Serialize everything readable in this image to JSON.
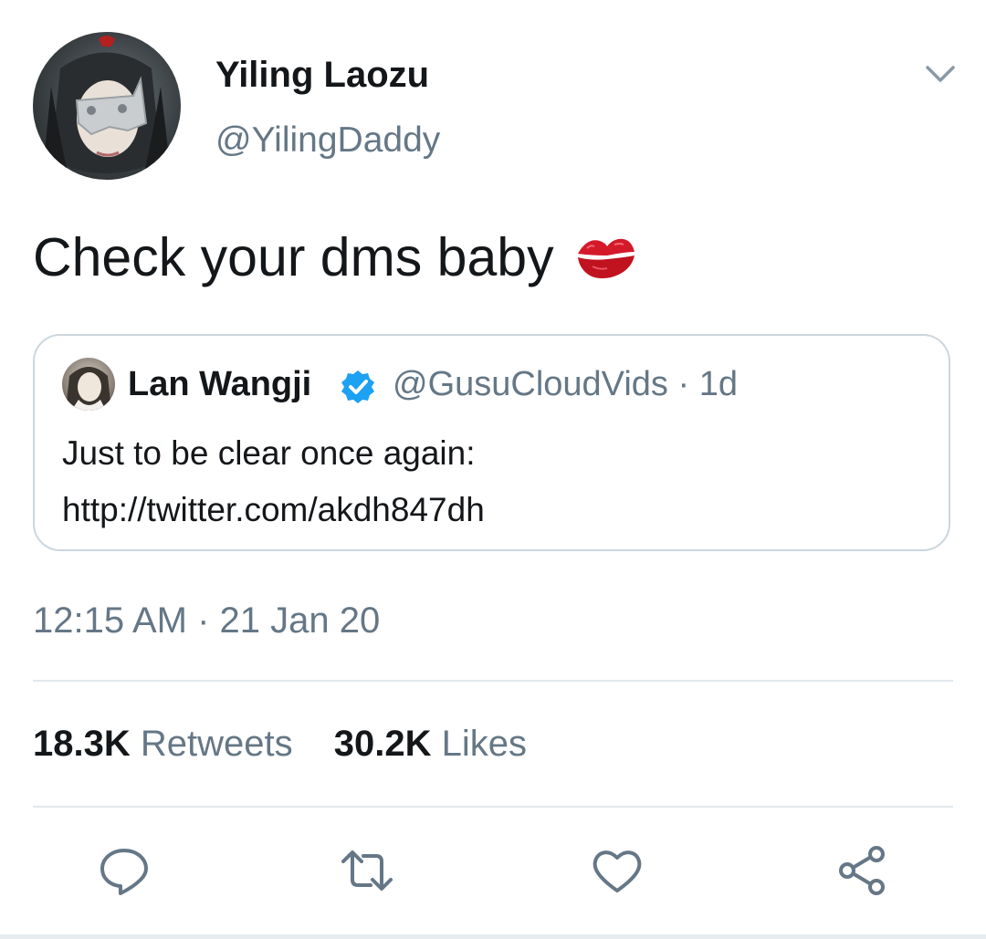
{
  "author": {
    "display_name": "Yiling Laozu",
    "handle": "@YilingDaddy"
  },
  "tweet_text": "Check your dms baby",
  "tweet_emoji": "kiss-mark-icon",
  "quoted_tweet": {
    "display_name": "Lan Wangji",
    "verified_icon": "verified-badge-icon",
    "handle_and_time": "@GusuCloudVids · 1d",
    "text_line1": "Just to be clear once again:",
    "text_line2": "http://twitter.com/akdh847dh"
  },
  "timestamp": "12:15 AM · 21 Jan 20",
  "stats": {
    "retweets_count": "18.3K",
    "retweets_label": "Retweets",
    "likes_count": "30.2K",
    "likes_label": "Likes"
  },
  "actions": [
    "reply-icon",
    "retweet-icon",
    "like-icon",
    "share-icon"
  ],
  "colors": {
    "text_primary": "#14171a",
    "text_secondary": "#657786",
    "border": "#ccd6dd",
    "verified": "#1da1f2",
    "icon": "#657786"
  }
}
